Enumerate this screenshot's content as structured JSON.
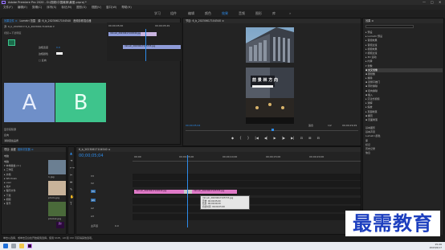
{
  "window": {
    "title": "Adobe Premiere Pro 2020 - D:\\视频\\中国最美\\最爱.prproj *",
    "min": "—",
    "max": "□",
    "close": "✕"
  },
  "menubar": [
    "文件(F)",
    "编辑(E)",
    "剪辑(C)",
    "序列(S)",
    "标记(M)",
    "图形(G)",
    "视图(V)",
    "窗口(W)",
    "帮助(H)"
  ],
  "workspaces": [
    "学习",
    "组件",
    "编辑",
    "颜色",
    "效果",
    "音频",
    "图形",
    "库"
  ],
  "active_workspace": "效果",
  "effect_controls": {
    "tabs": [
      "效果控件 ≡",
      "Lumetri 范围",
      "源: 6_b_20230617104540",
      "音频剪辑混合器"
    ],
    "row1": "源: 6_b_202306 ▾  6_b_20230617104540 ▾",
    "row2": "视频  ▸ 不透明度",
    "label_a": "A",
    "label_b": "B",
    "a_color": "#6f8fc8",
    "b_color": "#3ec48c",
    "param1": "边框宽度",
    "param1_val": "0.0",
    "param2": "边框颜色",
    "param3": "□ 反向",
    "time": "00:00:05:04",
    "bottom": [
      "显示实际源",
      "反向",
      "消除锯齿品质"
    ]
  },
  "source_timeline": {
    "timecode_left": "00;00;05;00",
    "timecode_right": "00;00;05;29",
    "clip1": "mhouh_20230617104540.jpg",
    "clip2": "mhouh_20230617105733.jpg"
  },
  "program": {
    "tab": "节目: 6_b_20230617104540 ≡",
    "timecode": "00;00;05;04",
    "fit": "适合",
    "duration": "00;00;29;29",
    "page_sign": "前 景 林 方 向",
    "full": "1/2",
    "controls": [
      "◆",
      "{",
      "}",
      "|◀",
      "◀|",
      "▶",
      "|▶",
      "▶|",
      "⊡",
      "⊞",
      "⊟"
    ]
  },
  "effects_panel": {
    "tab": "效果 ≡",
    "items": [
      {
        "label": "▸ 预设"
      },
      {
        "label": "▸ Lumetri 预设"
      },
      {
        "label": "▸ 音频效果"
      },
      {
        "label": "▸ 音频过渡"
      },
      {
        "label": "▸ 视频效果"
      },
      {
        "label": "▾ 视频过渡"
      },
      {
        "label": "  ▸ 3D 运动"
      },
      {
        "label": "  ▸ 内滑"
      },
      {
        "label": "  ▾ 划像"
      },
      {
        "label": "     ▪ 交叉划像",
        "selected": true
      },
      {
        "label": "     ▪ 圆划像"
      },
      {
        "label": "  ▸ 擦除"
      },
      {
        "label": "     ▪ 双侧平推门"
      },
      {
        "label": "     ▪ 带状擦除"
      },
      {
        "label": "     ▪ 径向擦除"
      },
      {
        "label": "     ▪ 插入"
      },
      {
        "label": "  ▸ 沉浸式视频"
      },
      {
        "label": "  ▸ 溶解"
      },
      {
        "label": "  ▸ 缩放"
      },
      {
        "label": "  ▸ 页面剥落"
      },
      {
        "label": "     ▪ 翻页"
      },
      {
        "label": "     ▪ 页面剥落"
      }
    ],
    "extra": [
      "基本图形",
      "基本声音",
      "Lumetri 颜色",
      "库",
      "标记",
      "历史记录",
      "信息"
    ]
  },
  "project": {
    "tabs": [
      "项目: 最爱",
      "媒体浏览器 ≡",
      "库",
      "信息",
      "效果"
    ],
    "path": "电脑",
    "tree": [
      "电脑",
      "▾ 本地磁盘 (C:)",
      "  ▸ 工作区",
      "  ▸ 文档",
      "  ▸ Windows",
      "  ▸ user",
      "  ▸ 用户",
      "  ▸ 程序文件",
      "  ▸ 下载",
      "  ▸ 视频",
      "  ▸ 音乐"
    ],
    "thumbs": [
      "1.jpg",
      "1.jpg",
      "photo.jpg",
      "photo2.jpg",
      "png.psd"
    ]
  },
  "timeline": {
    "tab": "6_b_20230617104540 ≡",
    "timecode": "00;00;05;04",
    "ruler": [
      "00;00",
      "00;00;05;00",
      "00;00;10;00",
      "00;00;15;00",
      "00;00;20;00",
      "00;00;25;00"
    ],
    "tracks": [
      "V3",
      "V2",
      "V1",
      "A1",
      "A2",
      "A3"
    ],
    "master": "主声道",
    "master_val": "0.0",
    "clip_v1a": "mhouh_20230617104540.jpg",
    "clip_v1b": "mhouh_20230617105733.jpg",
    "tooltip": [
      "mhouh_20230617105733.jpg",
      "开始: 00;00;05;00",
      "结束: 00;00;09;29",
      "持续时间: 00;00;05;00"
    ]
  },
  "status": "单击以选择，或单击空白处开始拖曳选择。使用 Shift、Alt 和 Ctrl 可获得其他选项。",
  "watermark": "最需教育",
  "taskbar": {
    "time": "15:26",
    "date": "2023/6/17"
  },
  "colors": {
    "accent": "#2d8ceb",
    "pink_clip": "#e07ac8",
    "blue_clip": "#8e9bd8"
  }
}
